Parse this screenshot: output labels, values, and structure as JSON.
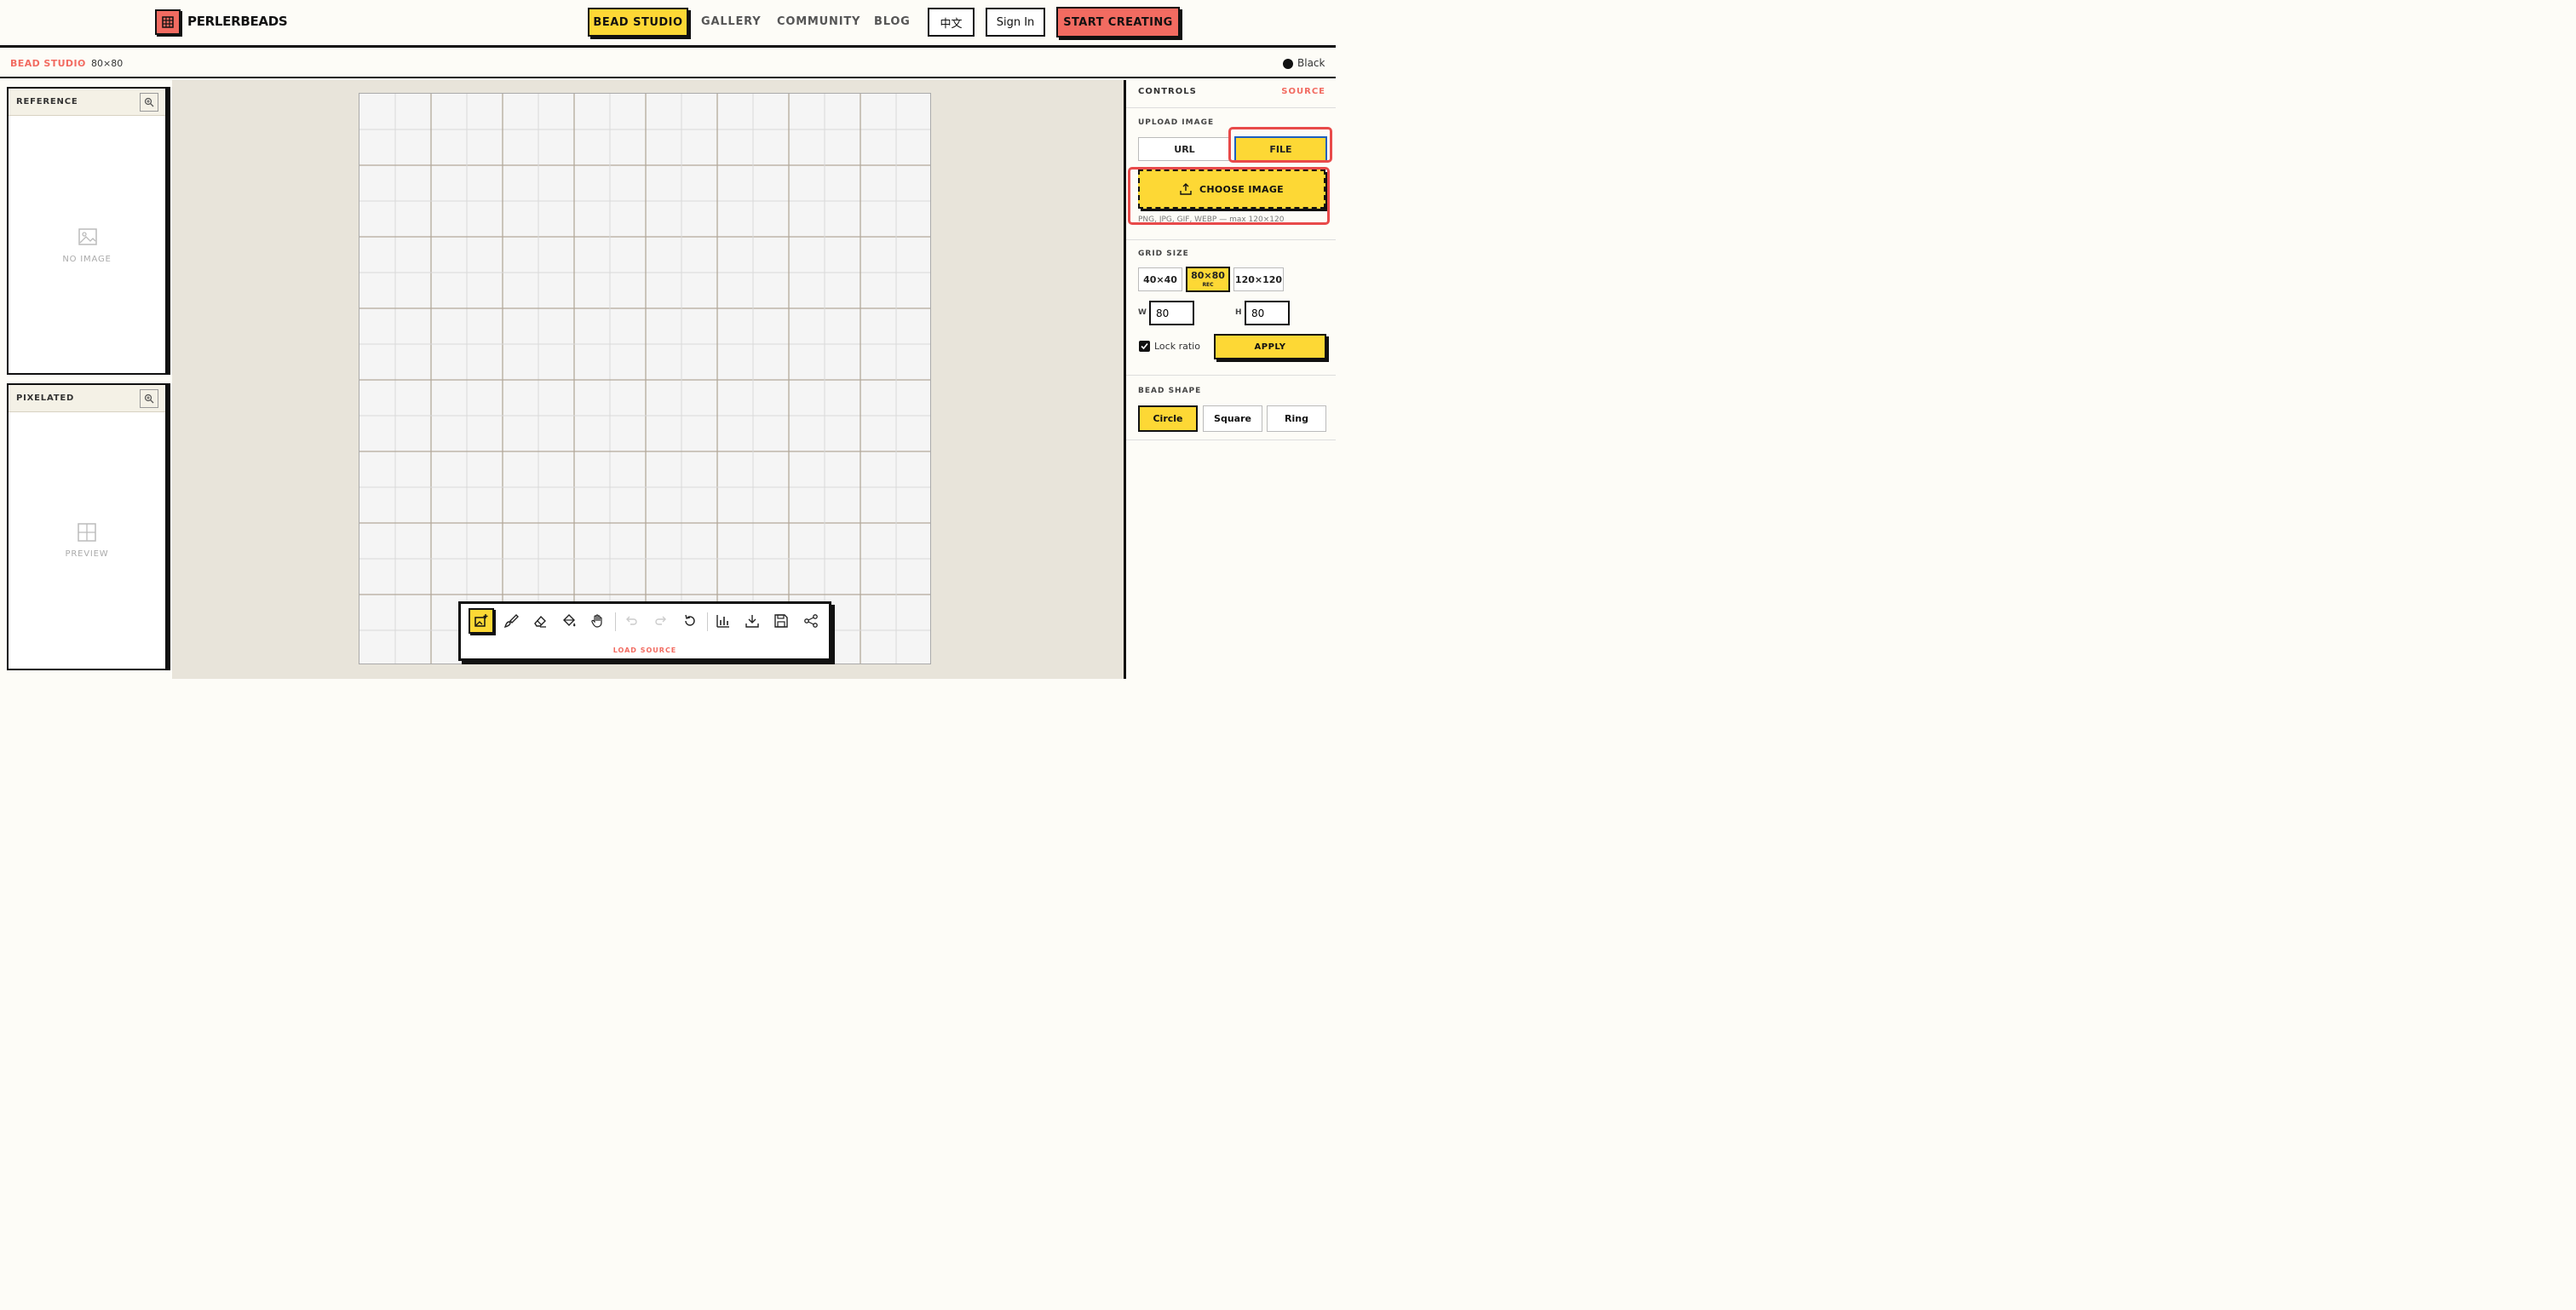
{
  "brand": {
    "name": "PERLERBEADS"
  },
  "nav": {
    "active": "BEAD STUDIO",
    "gallery": "GALLERY",
    "community": "COMMUNITY",
    "blog": "BLOG",
    "lang": "中文",
    "signin": "Sign In",
    "start": "START CREATING"
  },
  "breadcrumb": {
    "studio": "BEAD STUDIO",
    "sep": "·",
    "size": "80×80"
  },
  "current_color": {
    "name": "Black",
    "hex": "#111111"
  },
  "left": {
    "reference": {
      "title": "REFERENCE",
      "empty": "NO IMAGE"
    },
    "pixelated": {
      "title": "PIXELATED",
      "empty": "PREVIEW"
    }
  },
  "toolbar": {
    "tools": [
      "ai-image",
      "brush",
      "eraser",
      "fill-bucket",
      "pan-hand",
      "undo",
      "redo",
      "reset",
      "stats",
      "download",
      "save",
      "share"
    ],
    "caption": "LOAD SOURCE"
  },
  "controls": {
    "title": "CONTROLS",
    "source_link": "SOURCE",
    "upload": {
      "label": "UPLOAD IMAGE",
      "url_tab": "URL",
      "file_tab": "FILE",
      "choose": "CHOOSE IMAGE",
      "hint": "PNG, JPG, GIF, WEBP — max 120×120"
    },
    "grid": {
      "label": "GRID SIZE",
      "options": [
        "40×40",
        "80×80",
        "120×120"
      ],
      "rec": "REC",
      "w_label": "W",
      "h_label": "H",
      "w_value": "80",
      "h_value": "80",
      "lock": "Lock ratio",
      "apply": "APPLY"
    },
    "shape": {
      "label": "BEAD SHAPE",
      "options": [
        "Circle",
        "Square",
        "Ring"
      ]
    }
  },
  "colors": {
    "accent": "#fdd835",
    "brand": "#f26b61",
    "highlight": "#e84a4a"
  }
}
